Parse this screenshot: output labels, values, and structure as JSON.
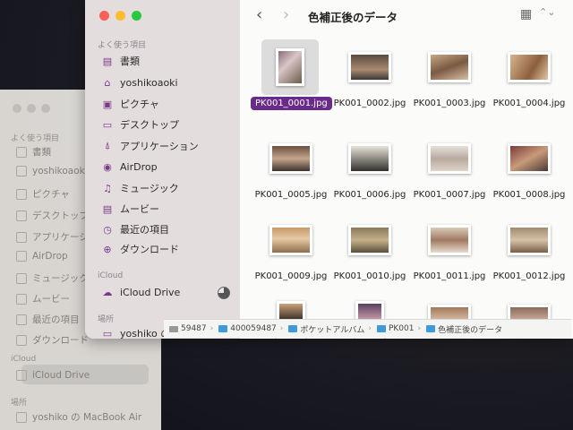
{
  "ghost_window": {
    "section_favorites": "よく使う項目",
    "items": [
      "書類",
      "yoshikoaoki",
      "ピクチャ",
      "デスクトップ",
      "アプリケーショ",
      "AirDrop",
      "ミュージック",
      "ムービー",
      "最近の項目",
      "ダウンロード"
    ],
    "section_icloud": "iCloud",
    "icloud_drive": "iCloud Drive",
    "section_locations": "場所",
    "location_item": "yoshiko の MacBook Air"
  },
  "sidebar": {
    "section_favorites": "よく使う項目",
    "items": [
      {
        "label": "書類",
        "icon": "document-icon",
        "glyph": "▤"
      },
      {
        "label": "yoshikoaoki",
        "icon": "home-icon",
        "glyph": "⌂"
      },
      {
        "label": "ピクチャ",
        "icon": "pictures-icon",
        "glyph": "▣"
      },
      {
        "label": "デスクトップ",
        "icon": "desktop-icon",
        "glyph": "▭"
      },
      {
        "label": "アプリケーション",
        "icon": "applications-icon",
        "glyph": "⍋"
      },
      {
        "label": "AirDrop",
        "icon": "airdrop-icon",
        "glyph": "◉"
      },
      {
        "label": "ミュージック",
        "icon": "music-icon",
        "glyph": "♫"
      },
      {
        "label": "ムービー",
        "icon": "movies-icon",
        "glyph": "▤"
      },
      {
        "label": "最近の項目",
        "icon": "recents-icon",
        "glyph": "◷"
      },
      {
        "label": "ダウンロード",
        "icon": "downloads-icon",
        "glyph": "⊕"
      }
    ],
    "section_icloud": "iCloud",
    "icloud_drive": {
      "label": "iCloud Drive",
      "icon": "cloud-icon",
      "glyph": "☁"
    },
    "section_locations": "場所",
    "location_item": {
      "label": "yoshiko の MacBook Air",
      "icon": "laptop-icon",
      "glyph": "▭"
    }
  },
  "toolbar": {
    "back_glyph": "‹",
    "forward_glyph": "›",
    "title": "色補正後のデータ",
    "view_glyph": "▦",
    "view_chevron": "⌃⌄"
  },
  "files": [
    {
      "name": "PK001_0001.jpg",
      "selected": true,
      "orientation": "portrait",
      "tone": "p1"
    },
    {
      "name": "PK001_0002.jpg",
      "selected": false,
      "orientation": "landscape",
      "tone": "p2"
    },
    {
      "name": "PK001_0003.jpg",
      "selected": false,
      "orientation": "landscape",
      "tone": "p3"
    },
    {
      "name": "PK001_0004.jpg",
      "selected": false,
      "orientation": "landscape",
      "tone": "p4"
    },
    {
      "name": "PK001_0005.jpg",
      "selected": false,
      "orientation": "landscape",
      "tone": "p5"
    },
    {
      "name": "PK001_0006.jpg",
      "selected": false,
      "orientation": "landscape",
      "tone": "p6"
    },
    {
      "name": "PK001_0007.jpg",
      "selected": false,
      "orientation": "landscape",
      "tone": "p7"
    },
    {
      "name": "PK001_0008.jpg",
      "selected": false,
      "orientation": "landscape",
      "tone": "p8"
    },
    {
      "name": "PK001_0009.jpg",
      "selected": false,
      "orientation": "landscape",
      "tone": "p9"
    },
    {
      "name": "PK001_0010.jpg",
      "selected": false,
      "orientation": "landscape",
      "tone": "p10"
    },
    {
      "name": "PK001_0011.jpg",
      "selected": false,
      "orientation": "landscape",
      "tone": "p11"
    },
    {
      "name": "PK001_0012.jpg",
      "selected": false,
      "orientation": "landscape",
      "tone": "p12"
    },
    {
      "name": "",
      "selected": false,
      "orientation": "portrait",
      "tone": "p13"
    },
    {
      "name": "",
      "selected": false,
      "orientation": "portrait",
      "tone": "p14"
    },
    {
      "name": "",
      "selected": false,
      "orientation": "landscape",
      "tone": "p15"
    },
    {
      "name": "",
      "selected": false,
      "orientation": "landscape",
      "tone": "p16"
    }
  ],
  "pathbar": [
    "59487",
    "400059487",
    "ポケットアルバム",
    "PK001",
    "色補正後のデータ"
  ]
}
